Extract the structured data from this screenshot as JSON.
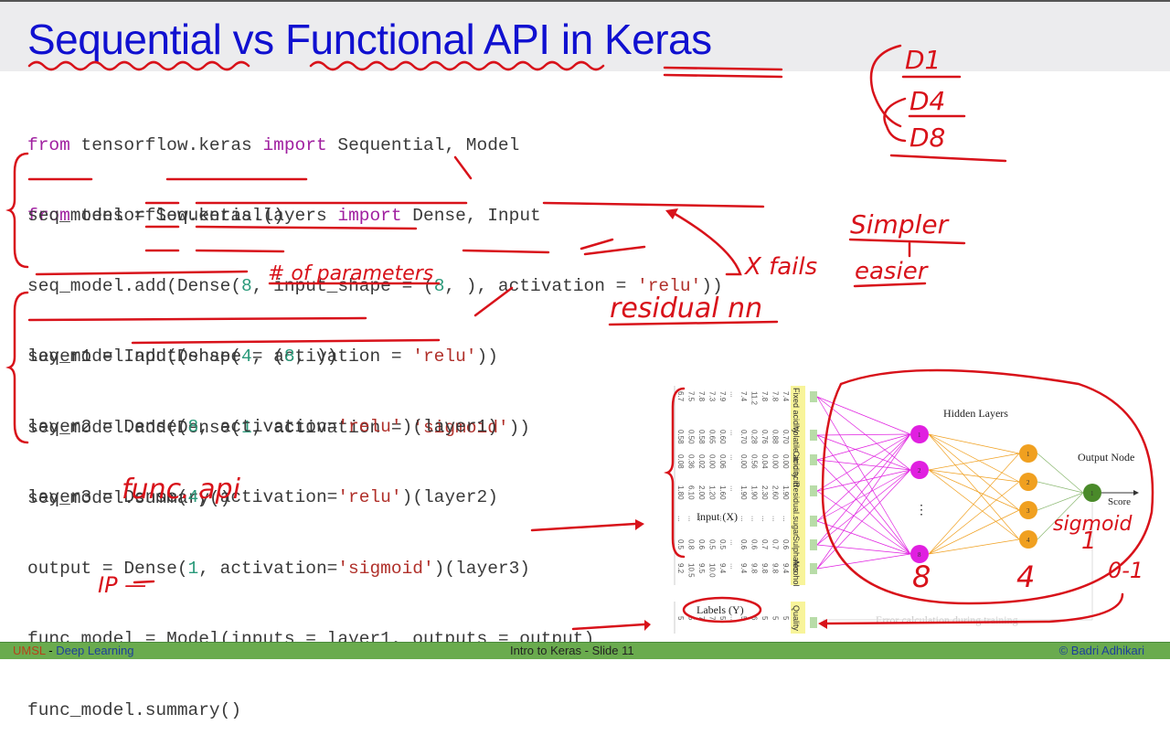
{
  "slide": {
    "title": "Sequential vs Functional API in Keras",
    "imports": [
      {
        "kw1": "from",
        "mod": " tensorflow.keras ",
        "kw2": "import",
        "names": " Sequential, Model"
      },
      {
        "kw1": "from",
        "mod": " tensorflow.keras.layers ",
        "kw2": "import",
        "names": " Dense, Input"
      }
    ],
    "sequential_code": [
      {
        "a": "seq_model = Sequential()"
      },
      {
        "a": "seq_model.add(Dense(",
        "n1": "8",
        "b": ", input_shape = (",
        "n2": "8",
        "c": ", ), activation = ",
        "s": "'relu'",
        "d": "))"
      },
      {
        "a": "seq_model.add(Dense(",
        "n1": "4",
        "b": ", activation = ",
        "s": "'relu'",
        "d": "))"
      },
      {
        "a": "seq_model.add(Dense(",
        "n1": "1",
        "b": ", activation = ",
        "s": "'sigmoid'",
        "d": "))"
      },
      {
        "a": "seq_model.summary()"
      }
    ],
    "functional_code": [
      {
        "a": "layer1 = Input(shape = (",
        "n1": "8",
        "b": ", ))"
      },
      {
        "a": "layer2 = Dense(",
        "n1": "8",
        "b": ", activation=",
        "s": "'relu'",
        "d": ")(layer1)"
      },
      {
        "a": "layer3 = Dense(",
        "n1": "4",
        "b": ", activation=",
        "s": "'relu'",
        "d": ")(layer2)"
      },
      {
        "a": "output = Dense(",
        "n1": "1",
        "b": ", activation=",
        "s": "'sigmoid'",
        "d": ")(layer3)"
      },
      {
        "a": "func_model = Model(inputs = layer1, outputs = output)"
      },
      {
        "a": "func_model.summary()"
      }
    ],
    "annotations": {
      "d1": "D1",
      "d4": "D4",
      "d8": "D8",
      "num_params": "# of parameters",
      "x_fails": "X fails",
      "simpler": "Simpler",
      "easier": "easier",
      "residual_nn": "residual nn",
      "func_api": "func. api",
      "ip": "IP —",
      "sigmoid": "sigmoid",
      "one": "1",
      "eight": "8",
      "four": "4",
      "range": "0-1"
    },
    "diagram": {
      "hidden_layers_label": "Hidden Layers",
      "output_node_label": "Output Node",
      "score_label": "Score",
      "input_label": "Input (X)",
      "labels_label": "Labels (Y)",
      "error_label": "Error calculation during training",
      "layer1_nodes": [
        "1",
        "2",
        "8"
      ],
      "layer2_nodes": [
        "1",
        "2",
        "3",
        "4"
      ],
      "output_nodes": [
        "1"
      ],
      "ellipsis": "⋮",
      "colors": {
        "layer1": "#e020e0",
        "layer2": "#f0a020",
        "output": "#4a8a2a",
        "feature_band": "#f8f49a"
      },
      "feature_headers": [
        "Fixed acidity",
        "Volatile acidity",
        "Citric acid",
        "Residual sugar",
        "...",
        "Sulphates",
        "Alcohol"
      ],
      "label_header": "Quality",
      "rows": [
        {
          "values": [
            "7.4",
            "0.70",
            "0.00",
            "1.90",
            "...",
            "0.6",
            "9.4"
          ],
          "label": "5"
        },
        {
          "values": [
            "7.8",
            "0.88",
            "0.00",
            "2.60",
            "...",
            "0.7",
            "9.8"
          ],
          "label": "5"
        },
        {
          "values": [
            "7.8",
            "0.76",
            "0.04",
            "2.30",
            "...",
            "0.7",
            "9.8"
          ],
          "label": "5"
        },
        {
          "values": [
            "11.2",
            "0.28",
            "0.56",
            "1.90",
            "...",
            "0.6",
            "9.8"
          ],
          "label": "6"
        },
        {
          "values": [
            "7.4",
            "0.70",
            "0.00",
            "1.90",
            "...",
            "0.6",
            "9.4"
          ],
          "label": "5"
        },
        {
          "values": [
            "...",
            "...",
            "...",
            "...",
            "...",
            "...",
            "..."
          ],
          "label": "..."
        },
        {
          "values": [
            "7.9",
            "0.60",
            "0.06",
            "1.60",
            "...",
            "0.5",
            "9.4"
          ],
          "label": "5"
        },
        {
          "values": [
            "7.3",
            "0.65",
            "0.00",
            "1.20",
            "...",
            "0.5",
            "10.0"
          ],
          "label": "7"
        },
        {
          "values": [
            "7.8",
            "0.58",
            "0.02",
            "2.00",
            "...",
            "0.6",
            "9.5"
          ],
          "label": "7"
        },
        {
          "values": [
            "7.5",
            "0.50",
            "0.36",
            "6.10",
            "...",
            "0.8",
            "10.5"
          ],
          "label": "5"
        },
        {
          "values": [
            "6.7",
            "0.58",
            "0.08",
            "1.80",
            "...",
            "0.5",
            "9.2"
          ],
          "label": "5"
        }
      ]
    },
    "footer": {
      "org": "UMSL",
      "sep": " - ",
      "course": "Deep Learning",
      "center": "Intro to Keras -  Slide  11",
      "copyright": "© Badri Adhikari"
    }
  }
}
